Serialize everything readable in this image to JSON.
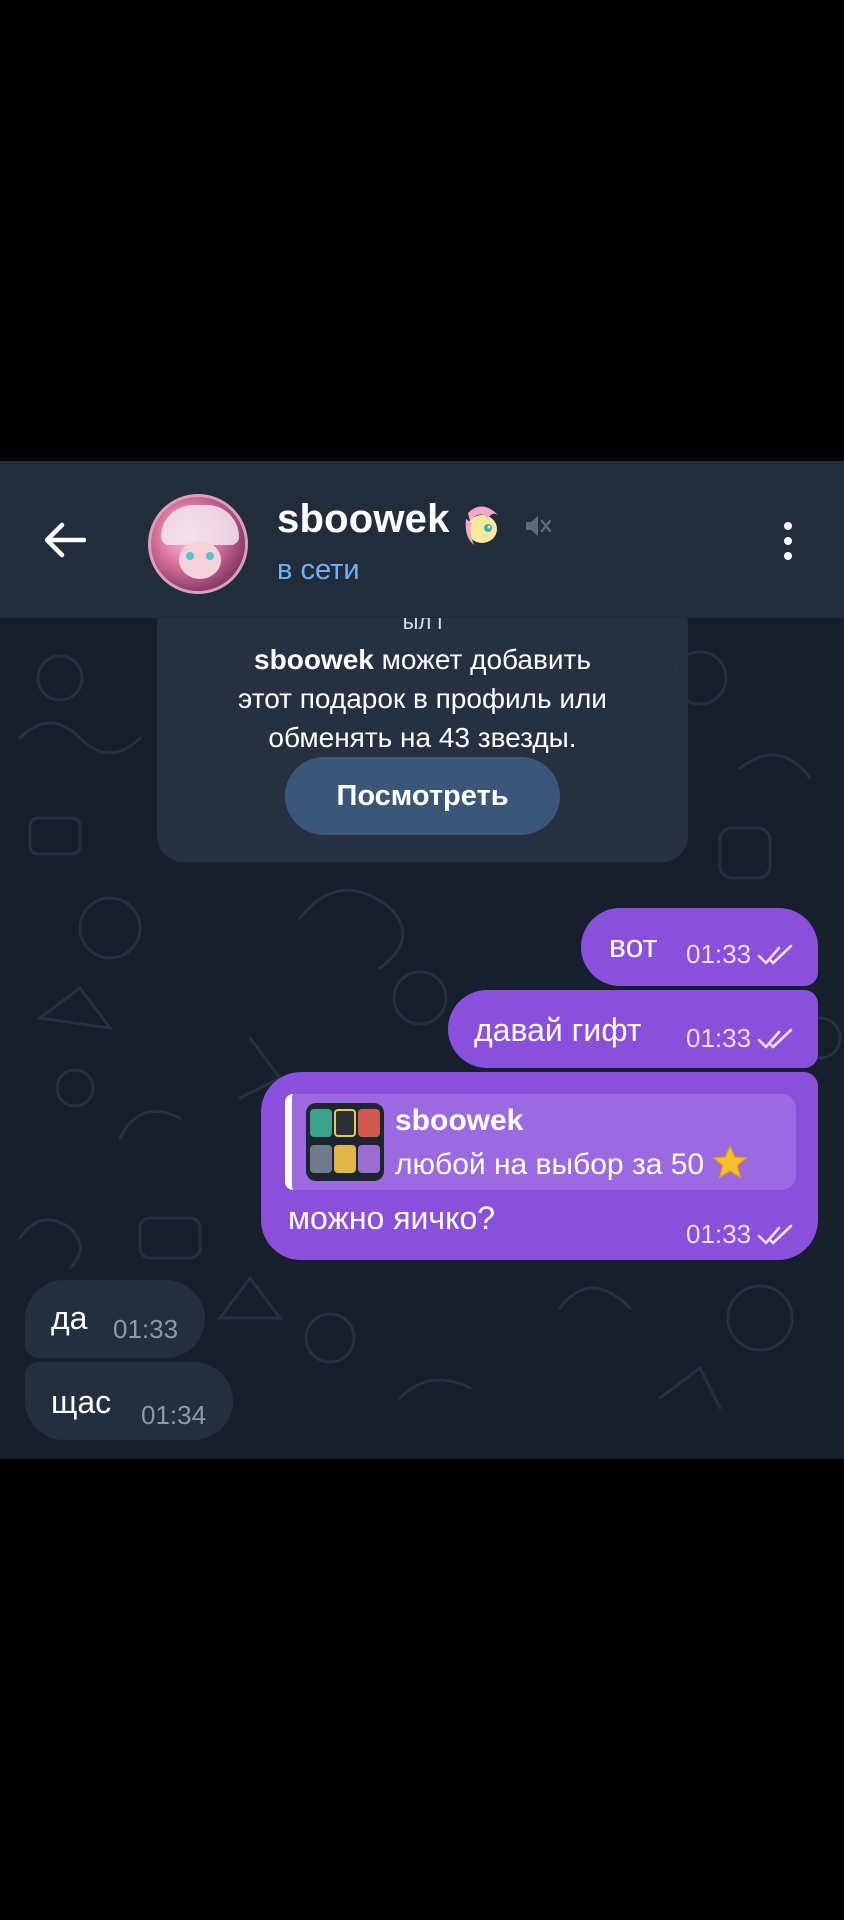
{
  "header": {
    "contact_name": "sboowek",
    "status": "в сети",
    "name_emoji_icon": "pony-emoji-icon",
    "muted": true
  },
  "gift_card": {
    "cut_text": "ыл і",
    "owner": "sboowek",
    "text_line1": " может добавить",
    "text_line2": "этот подарок в профиль или",
    "text_line3": "обменять на 43 звезды.",
    "button_label": "Посмотреть"
  },
  "messages": [
    {
      "direction": "out",
      "text": "вот",
      "time": "01:33",
      "read": true
    },
    {
      "direction": "out",
      "text": "давай гифт",
      "time": "01:33",
      "read": true
    },
    {
      "direction": "out",
      "text": "можно яичко?",
      "time": "01:33",
      "read": true,
      "reply": {
        "name": "sboowek",
        "text": "любой на выбор за 50",
        "icon": "star-icon"
      }
    },
    {
      "direction": "in",
      "text": "да",
      "time": "01:33"
    },
    {
      "direction": "in",
      "text": "щас",
      "time": "01:34"
    }
  ],
  "colors": {
    "header_bg": "#222d3b",
    "chat_bg": "#161f2c",
    "outgoing_bubble": "#8a4fdb",
    "incoming_bubble": "#232f3e",
    "status_accent": "#6fb3f3"
  }
}
